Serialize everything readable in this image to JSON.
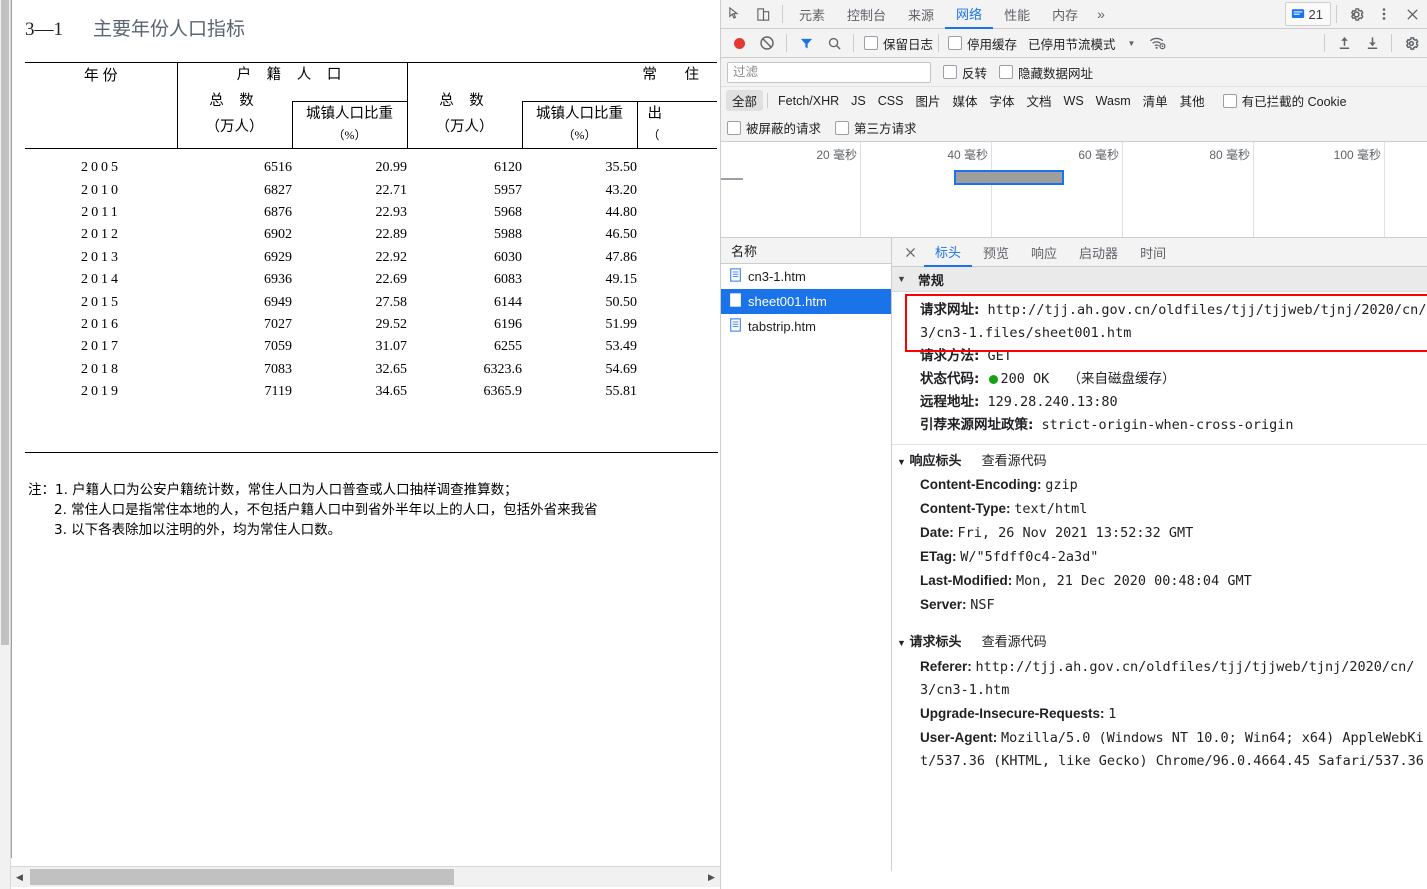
{
  "document": {
    "title_number": "3—1",
    "title_text": "主要年份人口指标",
    "table": {
      "group_headers": [
        {
          "label": "户 籍 人 口"
        },
        {
          "label": "常  住"
        }
      ],
      "col_year": "年      份",
      "col_total_1": "总      数",
      "col_total_1_unit": "（万人）",
      "col_urban_1": "城镇人口比重",
      "col_urban_1_unit": "（%）",
      "col_total_2": "总      数",
      "col_total_2_unit": "（万人）",
      "col_urban_2": "城镇人口比重",
      "col_urban_2_unit": "（%）",
      "col_birth_partial": "出",
      "col_birth_partial_unit": "（",
      "rows": [
        {
          "year": "2005",
          "hukou_total": "6516",
          "hukou_urban": "20.99",
          "resident_total": "6120",
          "resident_urban": "35.50"
        },
        {
          "year": "2010",
          "hukou_total": "6827",
          "hukou_urban": "22.71",
          "resident_total": "5957",
          "resident_urban": "43.20"
        },
        {
          "year": "2011",
          "hukou_total": "6876",
          "hukou_urban": "22.93",
          "resident_total": "5968",
          "resident_urban": "44.80"
        },
        {
          "year": "2012",
          "hukou_total": "6902",
          "hukou_urban": "22.89",
          "resident_total": "5988",
          "resident_urban": "46.50"
        },
        {
          "year": "2013",
          "hukou_total": "6929",
          "hukou_urban": "22.92",
          "resident_total": "6030",
          "resident_urban": "47.86"
        },
        {
          "year": "2014",
          "hukou_total": "6936",
          "hukou_urban": "22.69",
          "resident_total": "6083",
          "resident_urban": "49.15"
        },
        {
          "year": "2015",
          "hukou_total": "6949",
          "hukou_urban": "27.58",
          "resident_total": "6144",
          "resident_urban": "50.50"
        },
        {
          "year": "2016",
          "hukou_total": "7027",
          "hukou_urban": "29.52",
          "resident_total": "6196",
          "resident_urban": "51.99"
        },
        {
          "year": "2017",
          "hukou_total": "7059",
          "hukou_urban": "31.07",
          "resident_total": "6255",
          "resident_urban": "53.49"
        },
        {
          "year": "2018",
          "hukou_total": "7083",
          "hukou_urban": "32.65",
          "resident_total": "6323.6",
          "resident_urban": "54.69"
        },
        {
          "year": "2019",
          "hukou_total": "7119",
          "hukou_urban": "34.65",
          "resident_total": "6365.9",
          "resident_urban": "55.81"
        }
      ]
    },
    "notes": [
      "注：1.  户籍人口为公安户籍统计数，常住人口为人口普查或人口抽样调查推算数；",
      "2.  常住人口是指常住本地的人，不包括户籍人口中到省外半年以上的人口，包括外省来我省",
      "3.  以下各表除加以注明的外，均为常住人口数。"
    ]
  },
  "devtools": {
    "tabs": [
      {
        "label": "元素",
        "active": false
      },
      {
        "label": "控制台",
        "active": false
      },
      {
        "label": "来源",
        "active": false
      },
      {
        "label": "网络",
        "active": true
      },
      {
        "label": "性能",
        "active": false
      },
      {
        "label": "内存",
        "active": false
      }
    ],
    "more_tabs_glyph": "»",
    "message_count": "21",
    "toolbar": {
      "preserve_log": "保留日志",
      "disable_cache": "停用缓存",
      "throttle": "已停用节流模式",
      "throttle_caret": "▼"
    },
    "filter": {
      "placeholder": "过滤",
      "value": "",
      "invert": "反转",
      "hide_data_urls": "隐藏数据网址",
      "types": [
        "全部",
        "Fetch/XHR",
        "JS",
        "CSS",
        "图片",
        "媒体",
        "字体",
        "文档",
        "WS",
        "Wasm",
        "清单",
        "其他"
      ],
      "active_type": "全部",
      "blocked_cookies": "有已拦截的 Cookie",
      "blocked_requests": "被屏蔽的请求",
      "third_party": "第三方请求"
    },
    "overview": {
      "ticks": [
        "20 毫秒",
        "40 毫秒",
        "60 毫秒",
        "80 毫秒",
        "100 毫秒"
      ]
    },
    "request_list": {
      "header": "名称",
      "items": [
        {
          "name": "cn3-1.htm",
          "selected": false
        },
        {
          "name": "sheet001.htm",
          "selected": true
        },
        {
          "name": "tabstrip.htm",
          "selected": false
        }
      ]
    },
    "detail_tabs": [
      {
        "label": "标头",
        "active": true
      },
      {
        "label": "预览",
        "active": false
      },
      {
        "label": "响应",
        "active": false
      },
      {
        "label": "启动器",
        "active": false
      },
      {
        "label": "时间",
        "active": false
      }
    ],
    "sections": {
      "general": {
        "title": "常规",
        "request_url_key": "请求网址:",
        "request_url_value": "http://tjj.ah.gov.cn/oldfiles/tjj/tjjweb/tjnj/2020/cn/3/cn3-1.files/sheet001.htm",
        "request_method_key": "请求方法:",
        "request_method_value": "GET",
        "status_key": "状态代码:",
        "status_value": "200 OK",
        "status_note": "（来自磁盘缓存）",
        "remote_key": "远程地址:",
        "remote_value": "129.28.240.13:80",
        "referrer_policy_key": "引荐来源网址政策:",
        "referrer_policy_value": "strict-origin-when-cross-origin"
      },
      "response_headers": {
        "title": "响应标头",
        "view_source": "查看源代码",
        "items": [
          {
            "key": "Content-Encoding:",
            "value": "gzip"
          },
          {
            "key": "Content-Type:",
            "value": "text/html"
          },
          {
            "key": "Date:",
            "value": "Fri, 26 Nov 2021 13:52:32 GMT"
          },
          {
            "key": "ETag:",
            "value": "W/\"5fdff0c4-2a3d\""
          },
          {
            "key": "Last-Modified:",
            "value": "Mon, 21 Dec 2020 00:48:04 GMT"
          },
          {
            "key": "Server:",
            "value": "NSF"
          }
        ]
      },
      "request_headers": {
        "title": "请求标头",
        "view_source": "查看源代码",
        "items": [
          {
            "key": "Referer:",
            "value": "http://tjj.ah.gov.cn/oldfiles/tjj/tjjweb/tjnj/2020/cn/3/cn3-1.htm"
          },
          {
            "key": "Upgrade-Insecure-Requests:",
            "value": "1"
          },
          {
            "key": "User-Agent:",
            "value": "Mozilla/5.0 (Windows NT 10.0; Win64; x64) AppleWebKit/537.36 (KHTML, like Gecko) Chrome/96.0.4664.45 Safari/537.36"
          }
        ]
      }
    }
  },
  "colors": {
    "accent": "#1a73e8",
    "record": "#e53935",
    "status_ok": "#15a215",
    "highlight_box": "#ff0000"
  }
}
